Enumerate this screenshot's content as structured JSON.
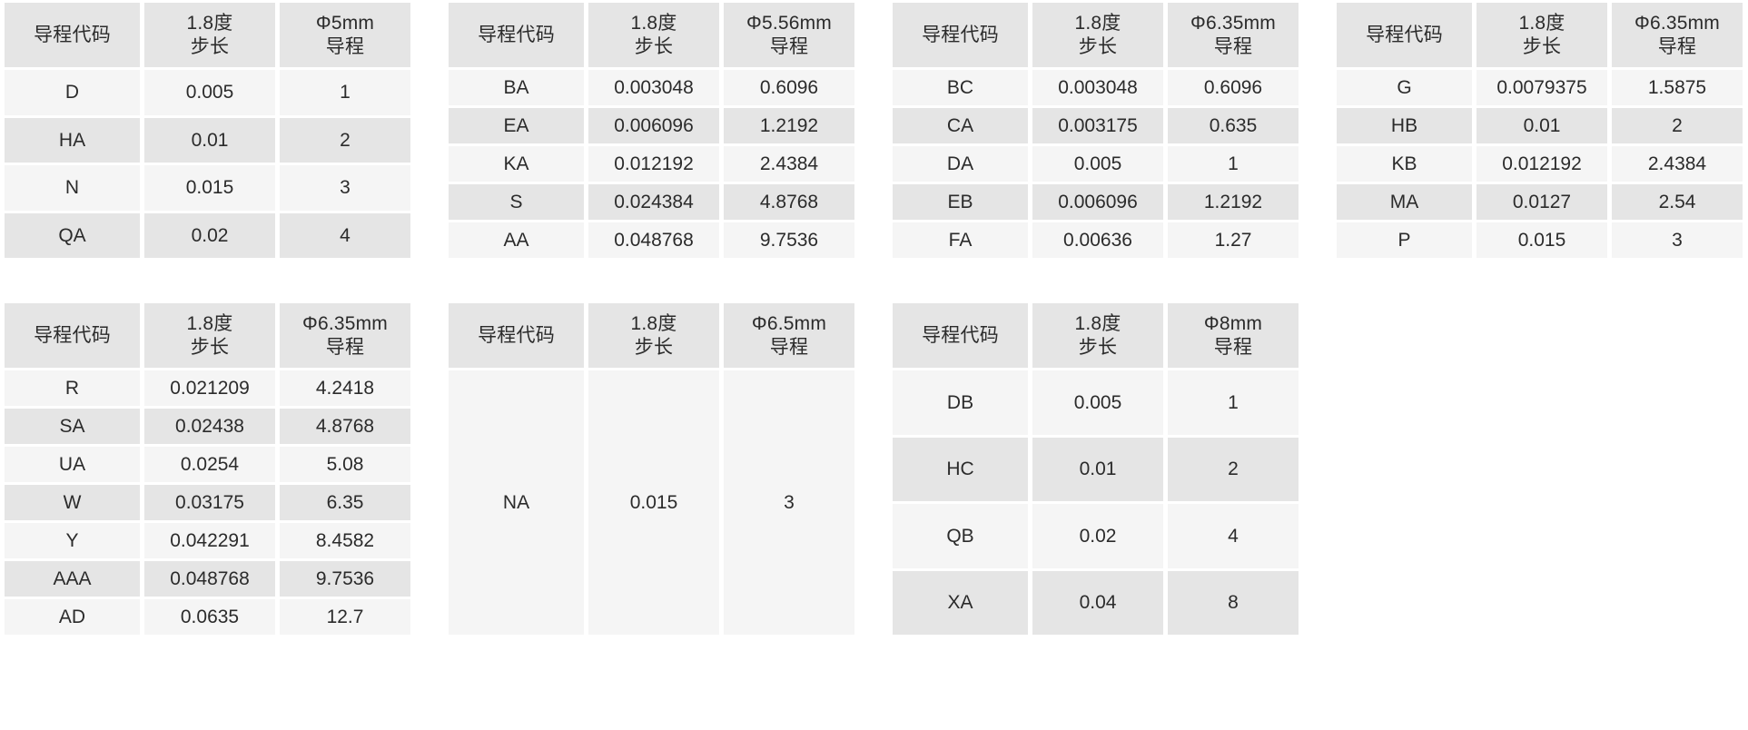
{
  "page": {
    "background_color": "#ffffff",
    "header_bg_color": "#e5e5e5",
    "row_odd_bg_color": "#f5f5f5",
    "row_even_bg_color": "#e5e5e5",
    "text_color": "#2b2b2b"
  },
  "common": {
    "col_code_header": "导程代码",
    "col_step_header_line1": "1.8度",
    "col_step_header_line2": "步长",
    "col_lead_header_line2": "导程"
  },
  "tables": [
    {
      "id": "table-phi5mm",
      "headers": {
        "code": "导程代码",
        "step_l1": "1.8度",
        "step_l2": "步长",
        "lead_l1": "Φ5mm",
        "lead_l2": "导程"
      },
      "rows": [
        {
          "code": "D",
          "step": "0.005",
          "lead": "1"
        },
        {
          "code": "HA",
          "step": "0.01",
          "lead": "2"
        },
        {
          "code": "N",
          "step": "0.015",
          "lead": "3"
        },
        {
          "code": "QA",
          "step": "0.02",
          "lead": "4"
        }
      ]
    },
    {
      "id": "table-phi5-56mm",
      "headers": {
        "code": "导程代码",
        "step_l1": "1.8度",
        "step_l2": "步长",
        "lead_l1": "Φ5.56mm",
        "lead_l2": "导程"
      },
      "rows": [
        {
          "code": "BA",
          "step": "0.003048",
          "lead": "0.6096"
        },
        {
          "code": "EA",
          "step": "0.006096",
          "lead": "1.2192"
        },
        {
          "code": "KA",
          "step": "0.012192",
          "lead": "2.4384"
        },
        {
          "code": "S",
          "step": "0.024384",
          "lead": "4.8768"
        },
        {
          "code": "AA",
          "step": "0.048768",
          "lead": "9.7536"
        }
      ]
    },
    {
      "id": "table-phi6-35mm-a",
      "headers": {
        "code": "导程代码",
        "step_l1": "1.8度",
        "step_l2": "步长",
        "lead_l1": "Φ6.35mm",
        "lead_l2": "导程"
      },
      "rows": [
        {
          "code": "BC",
          "step": "0.003048",
          "lead": "0.6096"
        },
        {
          "code": "CA",
          "step": "0.003175",
          "lead": "0.635"
        },
        {
          "code": "DA",
          "step": "0.005",
          "lead": "1"
        },
        {
          "code": "EB",
          "step": "0.006096",
          "lead": "1.2192"
        },
        {
          "code": "FA",
          "step": "0.00636",
          "lead": "1.27"
        }
      ]
    },
    {
      "id": "table-phi6-35mm-b",
      "headers": {
        "code": "导程代码",
        "step_l1": "1.8度",
        "step_l2": "步长",
        "lead_l1": "Φ6.35mm",
        "lead_l2": "导程"
      },
      "rows": [
        {
          "code": "G",
          "step": "0.0079375",
          "lead": "1.5875"
        },
        {
          "code": "HB",
          "step": "0.01",
          "lead": "2"
        },
        {
          "code": "KB",
          "step": "0.012192",
          "lead": "2.4384"
        },
        {
          "code": "MA",
          "step": "0.0127",
          "lead": "2.54"
        },
        {
          "code": "P",
          "step": "0.015",
          "lead": "3"
        }
      ]
    },
    {
      "id": "table-phi6-35mm-c",
      "headers": {
        "code": "导程代码",
        "step_l1": "1.8度",
        "step_l2": "步长",
        "lead_l1": "Φ6.35mm",
        "lead_l2": "导程"
      },
      "rows": [
        {
          "code": "R",
          "step": "0.021209",
          "lead": "4.2418"
        },
        {
          "code": "SA",
          "step": "0.02438",
          "lead": "4.8768"
        },
        {
          "code": "UA",
          "step": "0.0254",
          "lead": "5.08"
        },
        {
          "code": "W",
          "step": "0.03175",
          "lead": "6.35"
        },
        {
          "code": "Y",
          "step": "0.042291",
          "lead": "8.4582"
        },
        {
          "code": "AAA",
          "step": "0.048768",
          "lead": "9.7536"
        },
        {
          "code": "AD",
          "step": "0.0635",
          "lead": "12.7"
        }
      ]
    },
    {
      "id": "table-phi6-5mm",
      "headers": {
        "code": "导程代码",
        "step_l1": "1.8度",
        "step_l2": "步长",
        "lead_l1": "Φ6.5mm",
        "lead_l2": "导程"
      },
      "rows": [
        {
          "code": "NA",
          "step": "0.015",
          "lead": "3"
        }
      ]
    },
    {
      "id": "table-phi8mm",
      "headers": {
        "code": "导程代码",
        "step_l1": "1.8度",
        "step_l2": "步长",
        "lead_l1": "Φ8mm",
        "lead_l2": "导程"
      },
      "rows": [
        {
          "code": "DB",
          "step": "0.005",
          "lead": "1"
        },
        {
          "code": "HC",
          "step": "0.01",
          "lead": "2"
        },
        {
          "code": "QB",
          "step": "0.02",
          "lead": "4"
        },
        {
          "code": "XA",
          "step": "0.04",
          "lead": "8"
        }
      ]
    }
  ]
}
